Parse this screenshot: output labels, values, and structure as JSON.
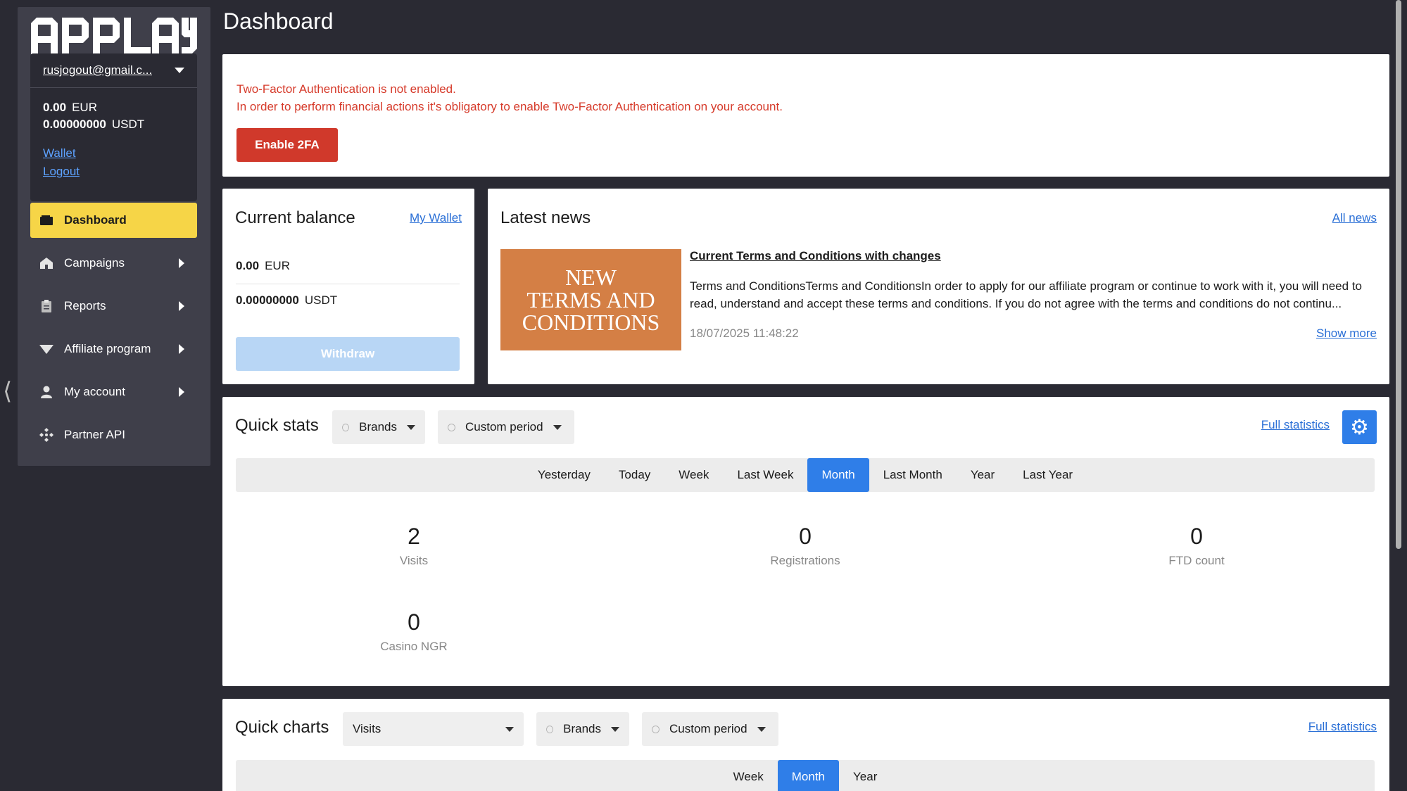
{
  "page": {
    "title": "Dashboard"
  },
  "account": {
    "email": "rusjogout@gmail.c...",
    "balances": [
      {
        "amount": "0.00",
        "currency": "EUR"
      },
      {
        "amount": "0.00000000",
        "currency": "USDT"
      }
    ],
    "wallet_link": "Wallet",
    "logout_link": "Logout"
  },
  "nav": {
    "items": [
      {
        "label": "Dashboard",
        "icon": "wallet-icon"
      },
      {
        "label": "Campaigns",
        "icon": "home-icon"
      },
      {
        "label": "Reports",
        "icon": "clipboard-icon"
      },
      {
        "label": "Affiliate program",
        "icon": "diamond-icon"
      },
      {
        "label": "My account",
        "icon": "user-icon"
      },
      {
        "label": "Partner API",
        "icon": "api-icon"
      }
    ]
  },
  "alert": {
    "line1": "Two-Factor Authentication is not enabled.",
    "line2": "In order to perform financial actions it's obligatory to enable Two-Factor Authentication on your account.",
    "button": "Enable 2FA"
  },
  "balance_card": {
    "title": "Current balance",
    "link": "My Wallet",
    "rows": [
      {
        "amount": "0.00",
        "currency": "EUR"
      },
      {
        "amount": "0.00000000",
        "currency": "USDT"
      }
    ],
    "withdraw": "Withdraw"
  },
  "news": {
    "title": "Latest news",
    "all_link": "All news",
    "image_lines": [
      "NEW",
      "TERMS AND",
      "CONDITIONS"
    ],
    "headline": "Current Terms and Conditions with changes",
    "body": "Terms and ConditionsTerms and ConditionsIn order to apply for our affiliate program or continue to work with it, you will need to read, understand and accept these terms and conditions. If you do not agree with the terms and conditions do not continu...",
    "date": "18/07/2025 11:48:22",
    "show_more": "Show more"
  },
  "quick_stats": {
    "title": "Quick stats",
    "brands": "Brands",
    "period": "Custom period",
    "full_link": "Full statistics",
    "tabs": [
      "Yesterday",
      "Today",
      "Week",
      "Last Week",
      "Month",
      "Last Month",
      "Year",
      "Last Year"
    ],
    "active_tab": "Month",
    "metrics": [
      {
        "value": "2",
        "label": "Visits"
      },
      {
        "value": "0",
        "label": "Registrations"
      },
      {
        "value": "0",
        "label": "FTD count"
      },
      {
        "value": "0",
        "label": "Casino NGR"
      }
    ]
  },
  "quick_charts": {
    "title": "Quick charts",
    "metric_select": "Visits",
    "brands": "Brands",
    "period": "Custom period",
    "full_link": "Full statistics",
    "tabs": [
      "Week",
      "Month",
      "Year"
    ],
    "active_tab": "Month"
  },
  "colors": {
    "accent_yellow": "#f6d547",
    "primary_blue": "#2f7ee8",
    "danger_red": "#d0392b",
    "sidebar_bg": "#3f3f4a",
    "page_bg": "#2a2a33"
  }
}
